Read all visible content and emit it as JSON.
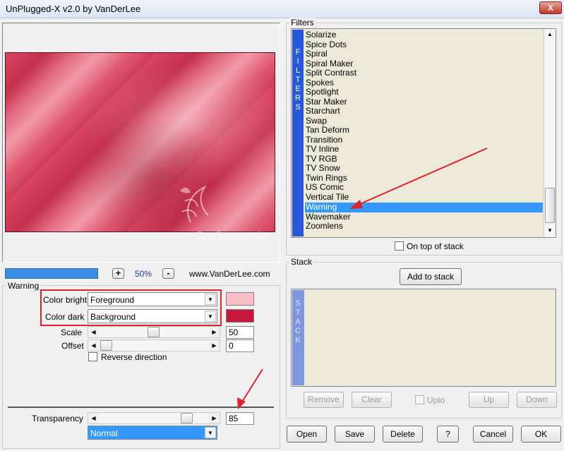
{
  "window": {
    "title": "UnPlugged-X v2.0 by VanDerLee",
    "close_label": "X"
  },
  "preview": {
    "zoom_in_label": "+",
    "zoom_value": "50%",
    "zoom_out_label": "-",
    "website": "www.VanDerLee.com",
    "watermark_text": "Graficamania",
    "progress_fraction": 1.0
  },
  "filter_panel": {
    "title": "Warning",
    "color_bright": {
      "label": "Color bright",
      "value": "Foreground",
      "swatch": "#f8bfc6"
    },
    "color_dark": {
      "label": "Color dark",
      "value": "Background",
      "swatch": "#c8173c"
    },
    "scale": {
      "label": "Scale",
      "value": "50",
      "fraction": 0.5
    },
    "offset": {
      "label": "Offset",
      "value": "0",
      "fraction": 0.0
    },
    "reverse_label": "Reverse direction",
    "transparency": {
      "label": "Transparency",
      "value": "85",
      "fraction": 0.85
    },
    "blend_mode": "Normal"
  },
  "filters": {
    "title": "Filters",
    "sidebar_letters": [
      "F",
      "I",
      "L",
      "T",
      "E",
      "R",
      "S"
    ],
    "items": [
      "Solarize",
      "Spice Dots",
      "Spiral",
      "Spiral Maker",
      "Split Contrast",
      "Spokes",
      "Spotlight",
      "Star Maker",
      "Starchart",
      "Swap",
      "Tan Deform",
      "Transition",
      "TV Inline",
      "TV RGB",
      "TV Snow",
      "Twin Rings",
      "US Comic",
      "Vertical Tile",
      "Warning",
      "Wavemaker",
      "Zoomlens"
    ],
    "selected": "Warning",
    "on_top_label": "On top of stack"
  },
  "stack": {
    "title": "Stack",
    "add_label": "Add to stack",
    "sidebar_letters": [
      "S",
      "T",
      "A",
      "C",
      "K"
    ],
    "remove_label": "Remove",
    "clear_label": "Clear",
    "upto_label": "Upto",
    "up_label": "Up",
    "down_label": "Down"
  },
  "footer": {
    "open_label": "Open",
    "save_label": "Save",
    "delete_label": "Delete",
    "help_label": "?",
    "cancel_label": "Cancel",
    "ok_label": "OK"
  },
  "colors": {
    "accent": "#3399ff",
    "highlight_box": "#e0222a",
    "annotation_arrow": "#e0222a"
  }
}
